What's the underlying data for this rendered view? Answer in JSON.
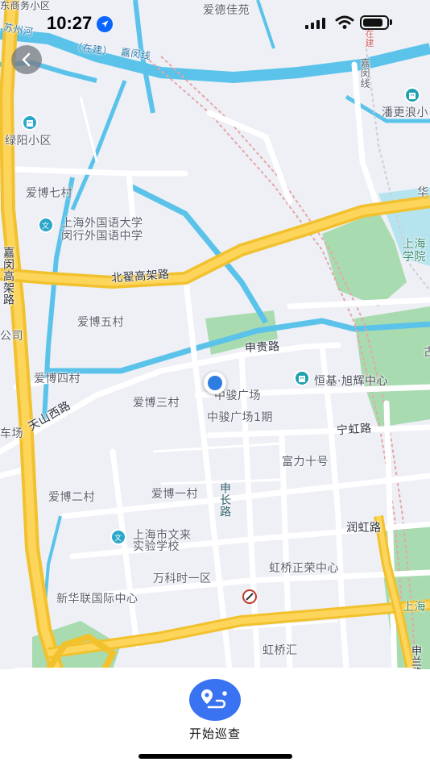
{
  "status_bar": {
    "time": "10:27",
    "battery_level": 0.85
  },
  "map": {
    "labels": {
      "aide_jiayuan": "爱德佳苑",
      "suzhou_he": "苏州河",
      "zaijian_line": "（在建）",
      "zaijian_line_tail": "嘉闵线",
      "top_left_area": "东商务小区",
      "top_left_area2": "",
      "zaijian_right": "在建",
      "jiamin_line": "嘉闵线",
      "panzeng_lang": "潘更浪小",
      "lvyang_xiaoqu": "绿阳小区",
      "aibo_qicun": "爱博七村",
      "sisu_name_1": "上海外国语大学",
      "sisu_name_2": "闵行外国语中学",
      "hua": "华",
      "shanghai_xueyuan_1": "上海",
      "shanghai_xueyuan_2": "学院",
      "jiamin_gaojia": "嘉闵高架路",
      "beizhai_gaojia": "北翟高架路",
      "aibo_wucun": "爱博五村",
      "gongsi": "公司",
      "shengui_lu": "申贵路",
      "aibo_sicun": "爱博四村",
      "hengji_xuhui": "恒基·旭辉中心",
      "zhongjun_guangchang": "中骏广场",
      "aibo_sancun": "爱博三村",
      "tianshan_xilu": "天山西路",
      "zhongjun_1qi": "中骏广场1期",
      "chechang": "车场",
      "ninghong_lu": "宁虹路",
      "fuli_shihao": "富力十号",
      "aibo_ercun": "爱博二村",
      "aibo_yicun": "爱博一村",
      "shenchang_lu": "申长路",
      "runhong_lu": "润虹路",
      "wenlai_1": "上海市文来",
      "wenlai_2": "实验学校",
      "hongqiao_zhengrong": "虹桥正荣中心",
      "wanke_shiyiqu": "万科时一区",
      "xinhua_lianguoji": "新华联国际中心",
      "hongqiao_hui": "虹桥汇",
      "shanghai_right": "上海",
      "shenlan_lu": "申兰路",
      "right_gu": "古"
    }
  },
  "bottom_sheet": {
    "action_label": "开始巡查"
  }
}
